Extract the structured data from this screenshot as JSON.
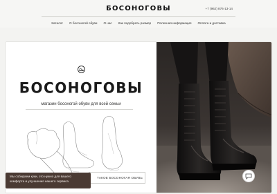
{
  "header": {
    "logo": "БОСОНОГОВЫ",
    "phone": "+7 (962) 876-13-14"
  },
  "nav": {
    "items": [
      "Каталог",
      "О босоногой обуви",
      "О нас",
      "Как подобрать размер",
      "Полезная информация",
      "Оплата и доставка"
    ]
  },
  "hero": {
    "brand": "БОСОНОГОВЫ",
    "tagline": "магазин босоногой обуви для всей семьи",
    "cta_label": "ТАКОЕ БОСОНОГАЯ ОБУВЬ",
    "emblem_icon": "shoe-emblem-icon",
    "illustration": "feet-sketch-illustration",
    "photo": "leather-boots-photo"
  },
  "cookie": {
    "text": "Мы собираем куки, это нужно для вашего комфорта и улучшения нашего сервиса"
  },
  "chat": {
    "icon": "chat-bubble-icon"
  },
  "colors": {
    "cookie_bg": "#4a3a33",
    "page_bg": "#f3f3f1",
    "text": "#222222"
  }
}
